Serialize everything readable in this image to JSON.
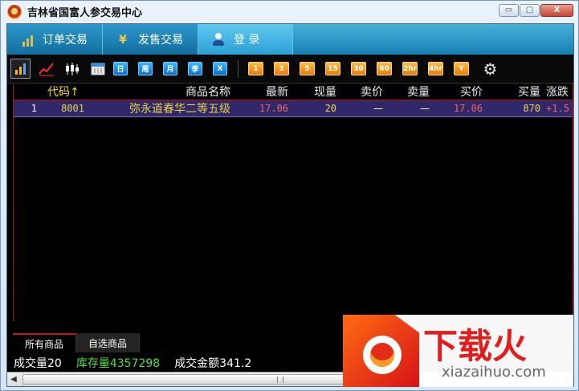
{
  "window": {
    "title": "吉林省国富人参交易中心",
    "controls": [
      "▭",
      "▢",
      "X"
    ]
  },
  "nav": {
    "tabs": [
      {
        "label": "订单交易",
        "icon": "bar-chart-icon"
      },
      {
        "label": "发售交易",
        "icon": "yen-icon"
      },
      {
        "label": "登 录",
        "icon": "user-icon"
      }
    ]
  },
  "toolbar": {
    "icons": [
      "bar-chart-icon",
      "line-chart-icon",
      "candlestick-icon",
      "calendar-icon"
    ],
    "period_blue": [
      "日",
      "周",
      "月",
      "季",
      "X"
    ],
    "period_orange": [
      "1",
      "3",
      "5",
      "15",
      "30",
      "60",
      "2hr",
      "4hr",
      "Y"
    ],
    "settings_icon": "gear-icon"
  },
  "table": {
    "columns": [
      "代码↑",
      "商品名称",
      "最新",
      "现量",
      "卖价",
      "卖量",
      "买价",
      "买量",
      "涨跌"
    ],
    "rows": [
      {
        "index": "1",
        "code": "8001",
        "name": "弥永道春华二等五级",
        "latest": "17.06",
        "volume": "20",
        "sell_price": "一",
        "sell_qty": "一",
        "buy_price": "17.06",
        "buy_qty": "870",
        "change": "+1.5"
      }
    ]
  },
  "bottom_tabs": [
    "所有商品",
    "自选商品"
  ],
  "status": {
    "trade_volume": "成交量20",
    "inventory": "库存量4357298",
    "trade_amount": "成交金额341.2"
  },
  "watermark": {
    "chinese": "下载火",
    "url": "xiazaihuo.com"
  },
  "colors": {
    "header_text": "#ececec",
    "code_header": "#f3dc1d",
    "price_red": "#f06262",
    "row_blue": "#31286a",
    "green_status": "#51df45",
    "nav_blue": "#1d8fc7",
    "watermark_red": "#e31c1c"
  }
}
